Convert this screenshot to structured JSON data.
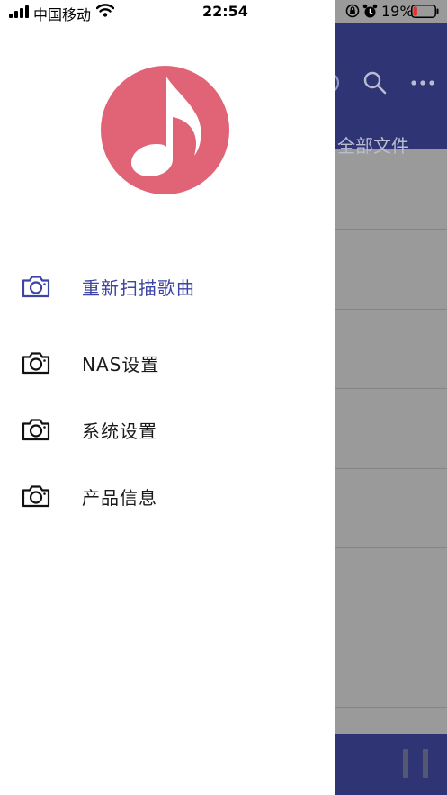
{
  "status_bar": {
    "carrier": "中国移动",
    "time": "22:54",
    "battery_percent": "19%",
    "battery_level": 0.19
  },
  "background_app": {
    "title": "全部文件",
    "header_color": "#2f3475"
  },
  "drawer": {
    "logo_icon": "music-note-icon",
    "logo_color": "#e06376",
    "active_color": "#3c44a4",
    "items": [
      {
        "label": "重新扫描歌曲",
        "icon": "camera-icon",
        "active": true
      },
      {
        "label": "NAS设置",
        "icon": "camera-icon",
        "active": false
      },
      {
        "label": "系统设置",
        "icon": "camera-icon",
        "active": false
      },
      {
        "label": "产品信息",
        "icon": "camera-icon",
        "active": false
      }
    ]
  }
}
